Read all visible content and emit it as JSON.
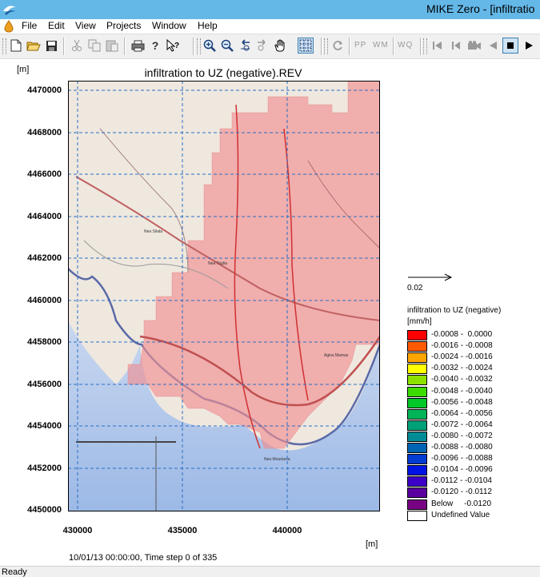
{
  "window": {
    "title": "MIKE Zero - [infiltratio"
  },
  "menu": {
    "items": [
      "File",
      "Edit",
      "View",
      "Projects",
      "Window",
      "Help"
    ]
  },
  "toolbar": {
    "icons": [
      "new-file-icon",
      "open-folder-icon",
      "save-icon",
      "cut-icon",
      "copy-icon",
      "paste-icon",
      "print-icon",
      "help-icon",
      "context-help-icon",
      "zoom-in-icon",
      "zoom-out-icon",
      "zoom-previous-icon",
      "zoom-next-icon",
      "pan-hand-icon",
      "grid-select-icon",
      "refresh-icon",
      "first-frame-icon",
      "previous-frame-icon",
      "camera-icon",
      "play-back-icon",
      "stop-icon",
      "play-forward-icon"
    ],
    "text_buttons": [
      "PP",
      "WM",
      "WQ"
    ]
  },
  "plot": {
    "title": "infiltration to UZ (negative).REV",
    "y_unit": "[m]",
    "x_unit": "[m]",
    "y_ticks": [
      "4470000",
      "4468000",
      "4466000",
      "4464000",
      "4462000",
      "4460000",
      "4458000",
      "4456000",
      "4454000",
      "4452000",
      "4450000"
    ],
    "x_ticks": [
      "430000",
      "435000",
      "440000"
    ],
    "time_text": "10/01/13 00:00:00, Time step 0 of 335",
    "map_labels": [
      "Nea Triglia",
      "Nea Silata",
      "Nea Moudania",
      "Agios Mamas"
    ]
  },
  "arrow_scale": {
    "label": "0.02"
  },
  "legend": {
    "title": "infiltration to UZ (negative)",
    "units": "[mm/h]",
    "entries": [
      {
        "label": "-0.0008 -  0.0000",
        "color": "#ff0000"
      },
      {
        "label": "-0.0016 - -0.0008",
        "color": "#ff5a00"
      },
      {
        "label": "-0.0024 - -0.0016",
        "color": "#ffa500"
      },
      {
        "label": "-0.0032 - -0.0024",
        "color": "#ffff00"
      },
      {
        "label": "-0.0040 - -0.0032",
        "color": "#8ee000"
      },
      {
        "label": "-0.0048 - -0.0040",
        "color": "#3cdc00"
      },
      {
        "label": "-0.0056 - -0.0048",
        "color": "#00c828"
      },
      {
        "label": "-0.0064 - -0.0056",
        "color": "#00b45a"
      },
      {
        "label": "-0.0072 - -0.0064",
        "color": "#00a078"
      },
      {
        "label": "-0.0080 - -0.0072",
        "color": "#008c96"
      },
      {
        "label": "-0.0088 - -0.0080",
        "color": "#0064b4"
      },
      {
        "label": "-0.0096 - -0.0088",
        "color": "#003cd2"
      },
      {
        "label": "-0.0104 - -0.0096",
        "color": "#0014e6"
      },
      {
        "label": "-0.0112 - -0.0104",
        "color": "#3c00c8"
      },
      {
        "label": "-0.0120 - -0.0112",
        "color": "#5a00a0"
      },
      {
        "label": "Below     -0.0120",
        "color": "#780082"
      },
      {
        "label": "Undefined Value",
        "color": "#ffffff"
      }
    ]
  },
  "status": {
    "text": "Ready"
  }
}
